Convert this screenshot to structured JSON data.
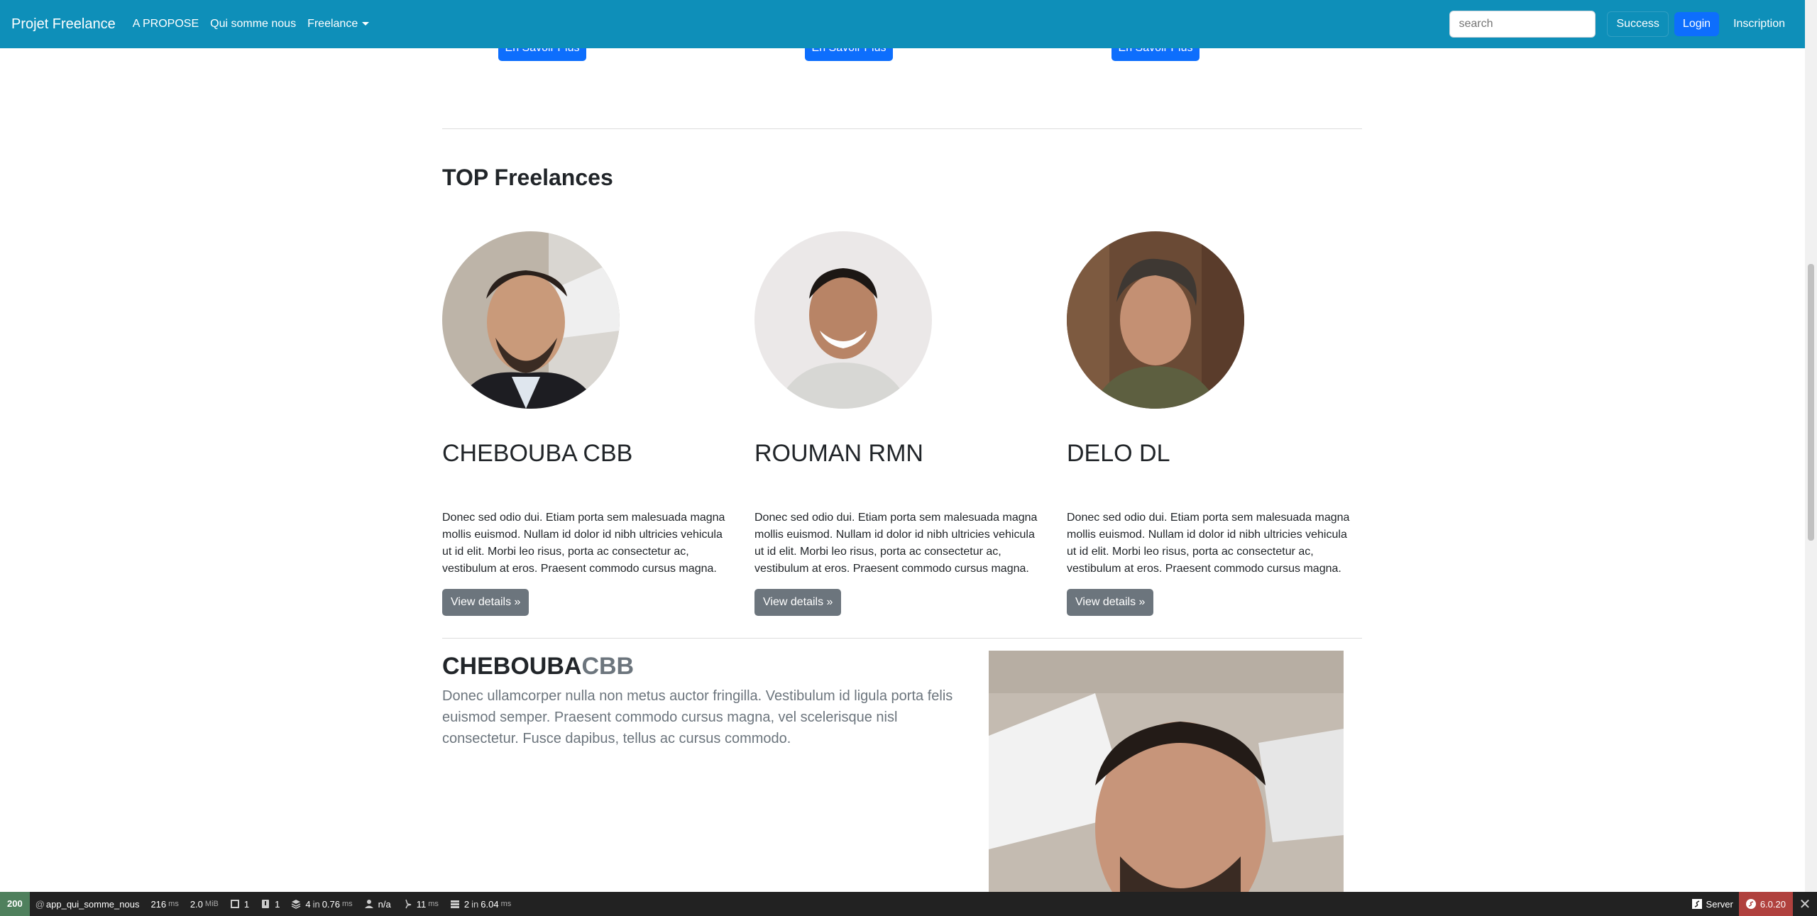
{
  "navbar": {
    "brand": "Projet Freelance",
    "links": [
      "A PROPOSE",
      "Qui somme nous"
    ],
    "dropdown_label": "Freelance",
    "search_placeholder": "search",
    "success_label": "Success",
    "login_label": "Login",
    "inscription_label": "Inscription",
    "bg_color": "#0e8fb9"
  },
  "top_buttons": [
    "En Savoir Plus",
    "En Savoir Plus",
    "En Savoir Plus"
  ],
  "section": {
    "title": "TOP Freelances"
  },
  "freelances": [
    {
      "name": "CHEBOUBA CBB",
      "text": "Donec sed odio dui. Etiam porta sem malesuada magna mollis euismod. Nullam id dolor id nibh ultricies vehicula ut id elit. Morbi leo risus, porta ac consectetur ac, vestibulum at eros. Praesent commodo cursus magna.",
      "button": "View details »"
    },
    {
      "name": "ROUMAN RMN",
      "text": "Donec sed odio dui. Etiam porta sem malesuada magna mollis euismod. Nullam id dolor id nibh ultricies vehicula ut id elit. Morbi leo risus, porta ac consectetur ac, vestibulum at eros. Praesent commodo cursus magna.",
      "button": "View details »"
    },
    {
      "name": "DELO DL",
      "text": "Donec sed odio dui. Etiam porta sem malesuada magna mollis euismod. Nullam id dolor id nibh ultricies vehicula ut id elit. Morbi leo risus, porta ac consectetur ac, vestibulum at eros. Praesent commodo cursus magna.",
      "button": "View details »"
    }
  ],
  "feature": {
    "title_main": "CHEBOUBA",
    "title_muted": "CBB",
    "lead": "Donec ullamcorper nulla non metus auctor fringilla. Vestibulum id ligula porta felis euismod semper. Praesent commodo cursus magna, vel scelerisque nisl consectetur. Fusce dapibus, tellus ac cursus commodo."
  },
  "toolbar": {
    "status": "200",
    "route": "app_qui_somme_nous",
    "time": "216",
    "time_unit": "ms",
    "memory": "2.0",
    "memory_unit": "MiB",
    "requests": "1",
    "logs": "1",
    "twig_count": "4",
    "twig_in": "in",
    "twig_time": "0.76",
    "twig_unit": "ms",
    "user": "n/a",
    "events_time": "11",
    "events_unit": "ms",
    "db_count": "2",
    "db_in": "in",
    "db_time": "6.04",
    "db_unit": "ms",
    "server_label": "Server",
    "version": "6.0.20"
  }
}
